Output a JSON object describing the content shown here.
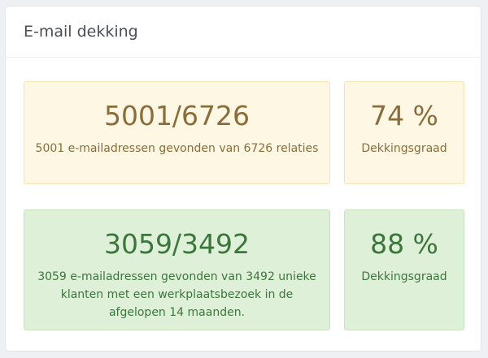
{
  "panel": {
    "title": "E-mail dekking"
  },
  "stats": {
    "email_all": {
      "value": "5001/6726",
      "description": "5001 e-mailadressen gevonden van 6726 relaties"
    },
    "coverage_all": {
      "value": "74 %",
      "description": "Dekkingsgraad"
    },
    "email_workshop": {
      "value": "3059/3492",
      "description": "3059 e-mailadressen gevonden van 3492 unieke klanten met een werkplaatsbezoek in de afgelopen 14 maanden."
    },
    "coverage_workshop": {
      "value": "88 %",
      "description": "Dekkingsgraad"
    }
  },
  "colors": {
    "warning_bg": "#fef7e3",
    "warning_text": "#8a6d3b",
    "success_bg": "#dff0d8",
    "success_text": "#3c763d"
  }
}
